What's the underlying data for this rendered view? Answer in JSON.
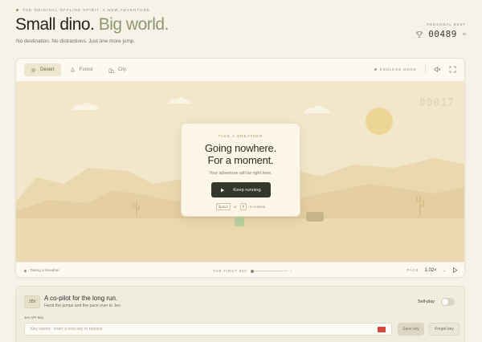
{
  "eyebrow": "THE ORIGINAL OFFLINE SPIRIT, A NEW ADVENTURE",
  "hero": {
    "title_main": "Small dino.",
    "title_accent": "Big world.",
    "subtitle": "No destination. No distractions. Just one more jump."
  },
  "personal_best": {
    "label": "PERSONAL BEST",
    "value": "00489",
    "unit": "m",
    "icon": "trophy-icon"
  },
  "game": {
    "tabs": [
      {
        "label": "Desert",
        "icon": "sun-icon",
        "active": true
      },
      {
        "label": "Forest",
        "icon": "tree-icon",
        "active": false
      },
      {
        "label": "City",
        "icon": "building-icon",
        "active": false
      }
    ],
    "mode_label": "ENDLESS MODE",
    "controls": [
      "mute-icon",
      "fullscreen-icon"
    ],
    "faded_score": "00017",
    "modal": {
      "kicker": "TAKE A BREATHER",
      "title_line1": "Going nowhere.",
      "title_line2": "For a moment.",
      "message": "Your adventure will be right here.",
      "button": "Keep running",
      "hint_key1": "Space",
      "hint_or": "or",
      "hint_key2": "P",
      "hint_suffix": "to resume"
    },
    "footer": {
      "status": "Taking a breather",
      "milestone_label": "THE FIRST 500",
      "milestone_progress": 0.0,
      "pace_label": "PACE",
      "pace_value": "1.02×"
    }
  },
  "copilot": {
    "badge": "JEV",
    "title": "A co-pilot for the long run.",
    "subtitle": "Hand the jumps and the pace over to Jev.",
    "selfplay_label": "Self-play",
    "selfplay_on": false,
    "api_label": "Jev API key",
    "api_placeholder": "Key saved · enter a new key to replace",
    "save_button": "Save key",
    "forget_button": "Forget key"
  },
  "colors": {
    "accent": "#8e9870",
    "sky": "#f3e7cb",
    "sun": "#edd596",
    "button_dark": "#33382b"
  }
}
